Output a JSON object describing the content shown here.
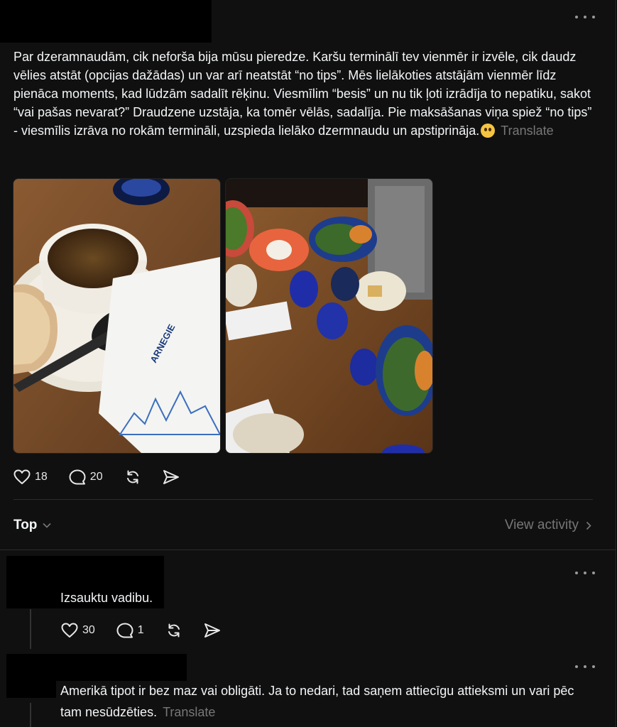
{
  "post": {
    "text": "Par dzeramnaudām, cik neforša bija mūsu pieredze. Karšu terminālī tev vienmēr ir izvēle, cik daudz vēlies atstāt (opcijas dažādas) un var arī neatstāt “no tips”. Mēs lielākoties atstājām vienmēr līdz pienāca moments, kad lūdzām sadalīt rēķinu. Viesmīlim “besis” un nu tik ļoti izrādīja to nepatiku, sakot “vai pašas nevarat?” Draudzene uzstāja, ka tomēr vēlās, sadalīja. Pie maksāšanas viņa spiež “no tips” - viesmīlis izrāva no rokām termināli, uzspieda lielāko dzermnaudu un apstiprināja.",
    "translate_label": "Translate",
    "emoji_icon": "exploding-head-emoji",
    "images": [
      {
        "description": "soup-bowl-photo"
      },
      {
        "description": "restaurant-table-photo",
        "sign_text": "ARNEGIE"
      }
    ],
    "likes": "18",
    "replies": "20"
  },
  "sort": {
    "label": "Top",
    "view_activity": "View activity"
  },
  "comments": [
    {
      "text": "Izsauktu vadibu.",
      "likes": "30",
      "replies": "1"
    },
    {
      "text": "Amerikā tipot ir bez maz vai obligāti. Ja to nedari, tad saņem attiecīgu attieksmi un vari pēc tam nesūdzēties.",
      "translate_label": "Translate"
    }
  ],
  "colors": {
    "background": "#101010",
    "text": "#f3f5f7",
    "muted": "#777777",
    "divider": "#2c2c2c"
  }
}
